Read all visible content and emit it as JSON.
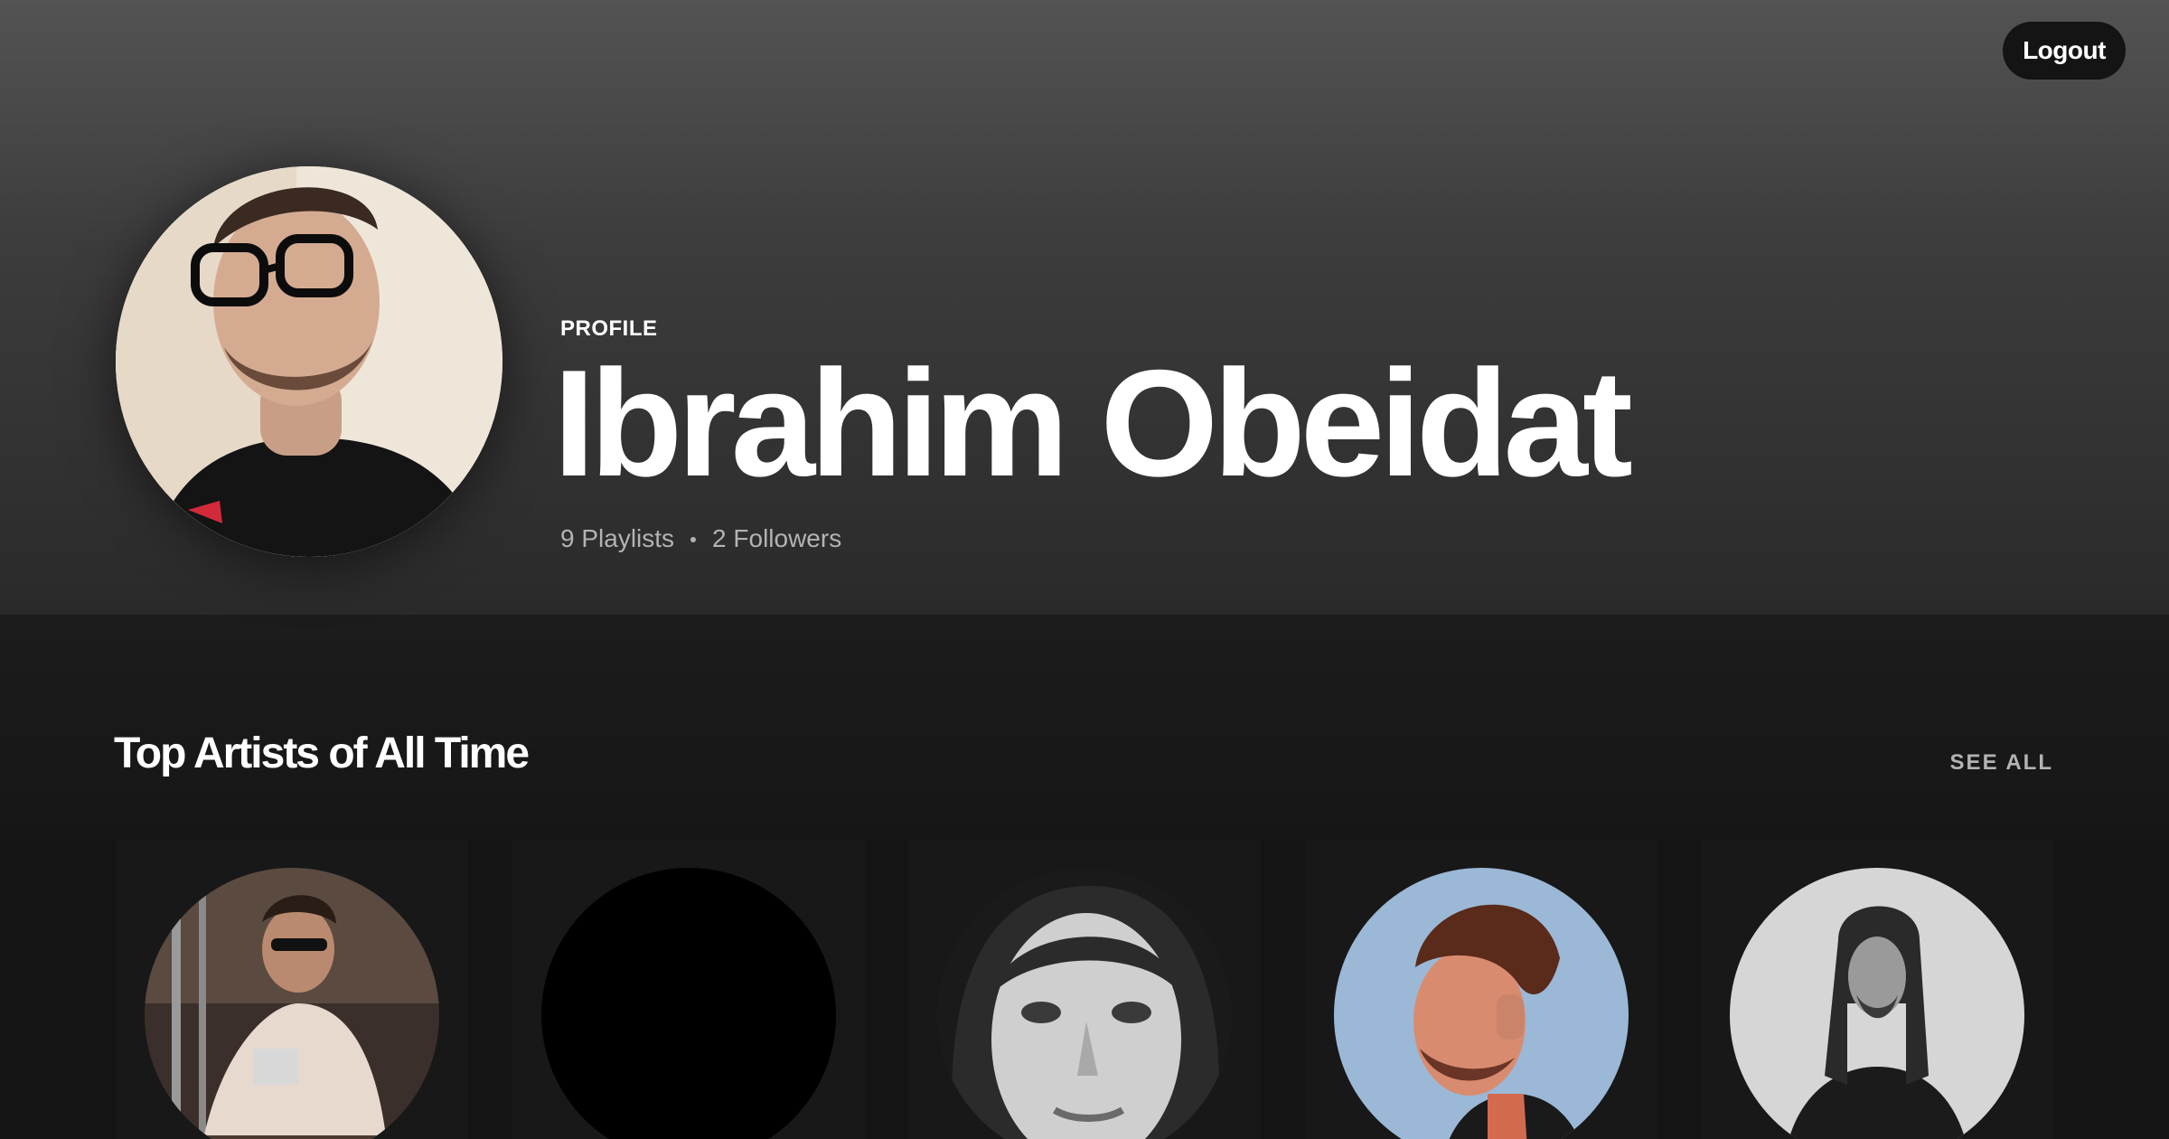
{
  "header": {
    "logout_label": "Logout"
  },
  "profile": {
    "label": "PROFILE",
    "name": "Ibrahim Obeidat",
    "playlists": "9 Playlists",
    "followers": "2 Followers",
    "avatar_icon": "user-avatar-photo"
  },
  "top_artists": {
    "title": "Top Artists of All Time",
    "see_all_label": "SEE ALL",
    "artists": [
      {
        "icon": "artist-photo-1"
      },
      {
        "icon": "artist-photo-2"
      },
      {
        "icon": "artist-photo-3"
      },
      {
        "icon": "artist-photo-4"
      },
      {
        "icon": "artist-photo-5"
      }
    ]
  },
  "colors": {
    "background": "#121212",
    "hero_top": "#535353",
    "text_primary": "#ffffff",
    "text_secondary": "#b3b3b3",
    "button_bg": "#141414"
  }
}
